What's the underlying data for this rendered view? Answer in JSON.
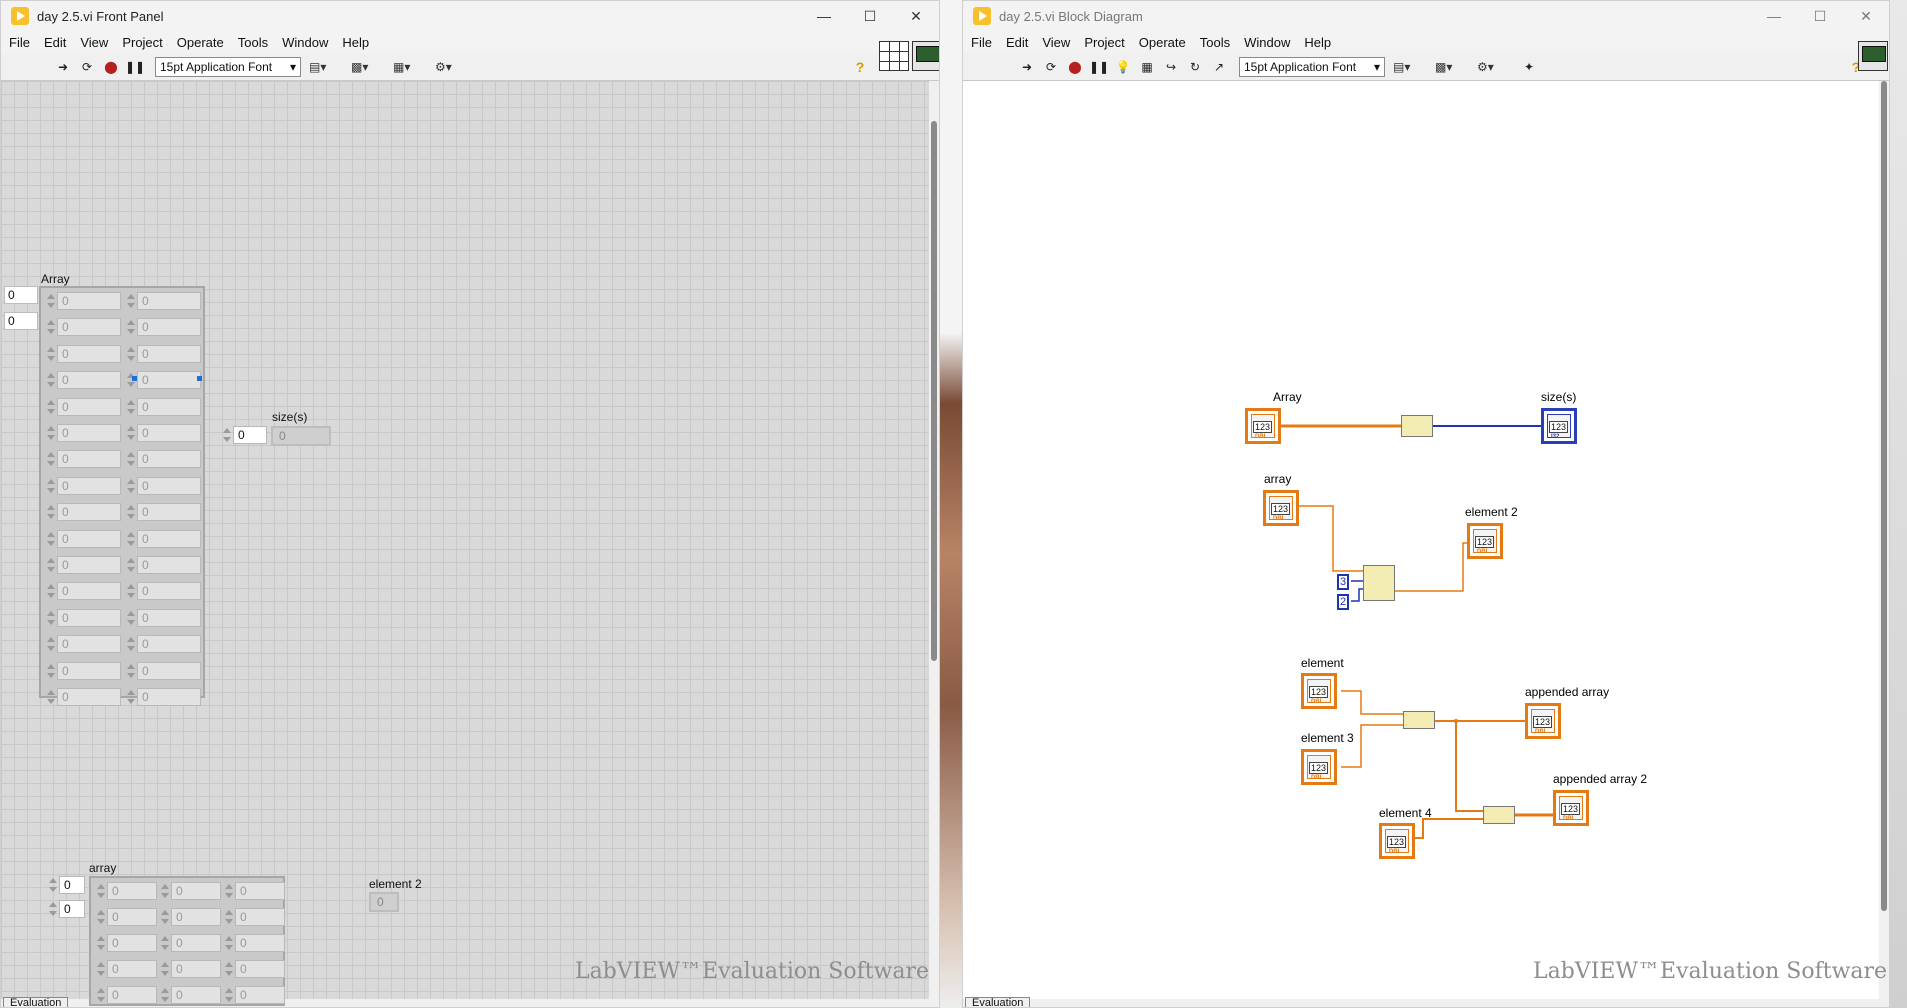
{
  "front_panel": {
    "title": "day 2.5.vi Front Panel",
    "menu": [
      "File",
      "Edit",
      "View",
      "Project",
      "Operate",
      "Tools",
      "Window",
      "Help"
    ],
    "font": "15pt Application Font",
    "watermark": "LabVIEW™Evaluation Software",
    "status": "Evaluation",
    "array_label": "Array",
    "array_index": [
      "0",
      "0"
    ],
    "array_cell": "0",
    "sizes_label": "size(s)",
    "sizes_index": "0",
    "sizes_value": "0",
    "array2_label": "array",
    "array2_index": [
      "0",
      "0"
    ],
    "element2_label": "element 2",
    "element2_value": "0"
  },
  "block_diagram": {
    "title": "day 2.5.vi Block Diagram",
    "menu": [
      "File",
      "Edit",
      "View",
      "Project",
      "Operate",
      "Tools",
      "Window",
      "Help"
    ],
    "font": "15pt Application Font",
    "watermark": "LabVIEW™Evaluation Software",
    "status": "Evaluation",
    "labels": {
      "array": "Array",
      "sizes": "size(s)",
      "array2": "array",
      "element2": "element 2",
      "element": "element",
      "element3": "element 3",
      "element4": "element 4",
      "appended": "appended array",
      "appended2": "appended array 2"
    },
    "const_row": "3",
    "const_col": "2",
    "num_glyph": "123",
    "dbl_tag": "DBL"
  },
  "colors": {
    "wire_orange": "#e57a12",
    "wire_blue": "#1f33b4",
    "node_fill": "#f3edb4"
  }
}
